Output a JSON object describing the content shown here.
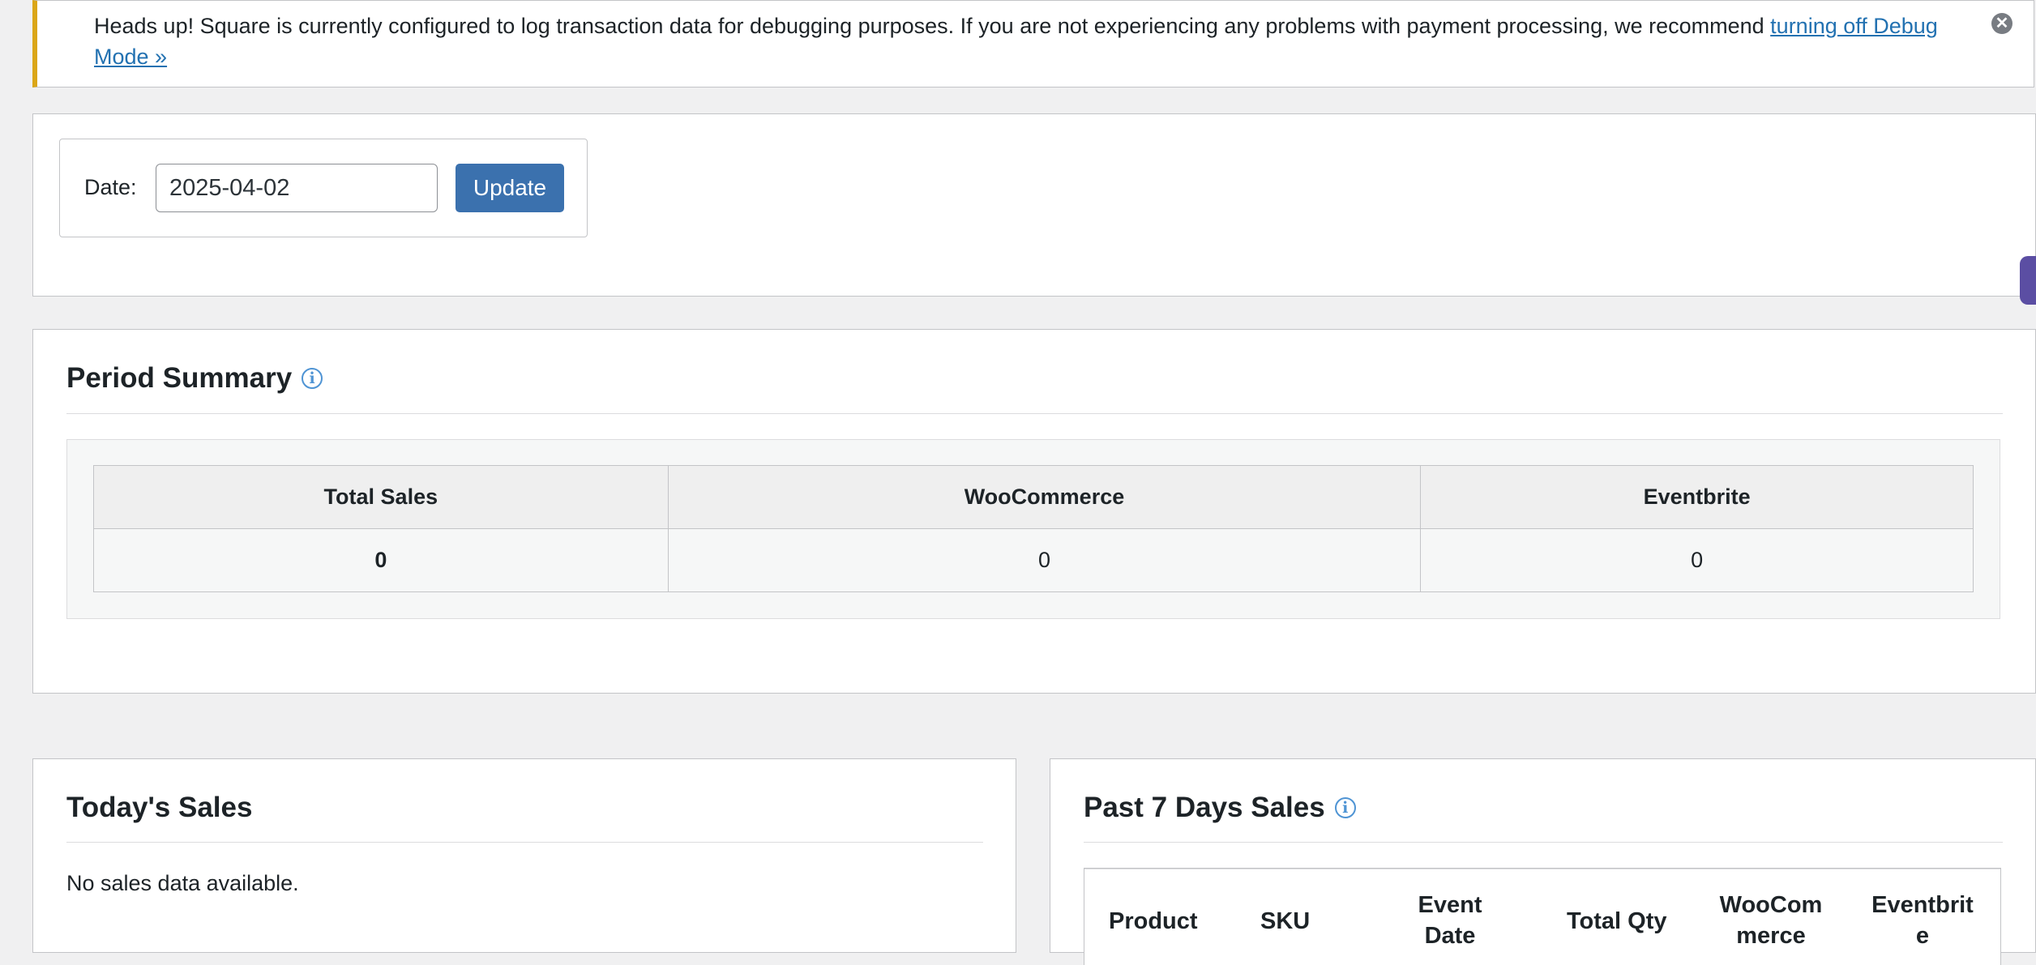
{
  "notice": {
    "text": "Heads up! Square is currently configured to log transaction data for debugging purposes. If you are not experiencing any problems with payment processing, we recommend ",
    "link": "turning off Debug Mode »",
    "dismiss": "✕"
  },
  "date_form": {
    "label": "Date:",
    "value": "2025-04-02",
    "button": "Update"
  },
  "period_summary": {
    "title": "Period Summary",
    "info": "i",
    "headers": [
      "Total Sales",
      "WooCommerce",
      "Eventbrite"
    ],
    "values": [
      "0",
      "0",
      "0"
    ]
  },
  "todays_sales": {
    "title": "Today's Sales",
    "empty": "No sales data available."
  },
  "past_sales": {
    "title": "Past 7 Days Sales",
    "info": "i",
    "columns": [
      "Product",
      "SKU",
      "Event Date",
      "Total Qty",
      "WooCommerce",
      "Eventbrite"
    ]
  },
  "colors": {
    "accent": "#3b71ae",
    "notice_border": "#dba617",
    "link": "#2271b1"
  }
}
